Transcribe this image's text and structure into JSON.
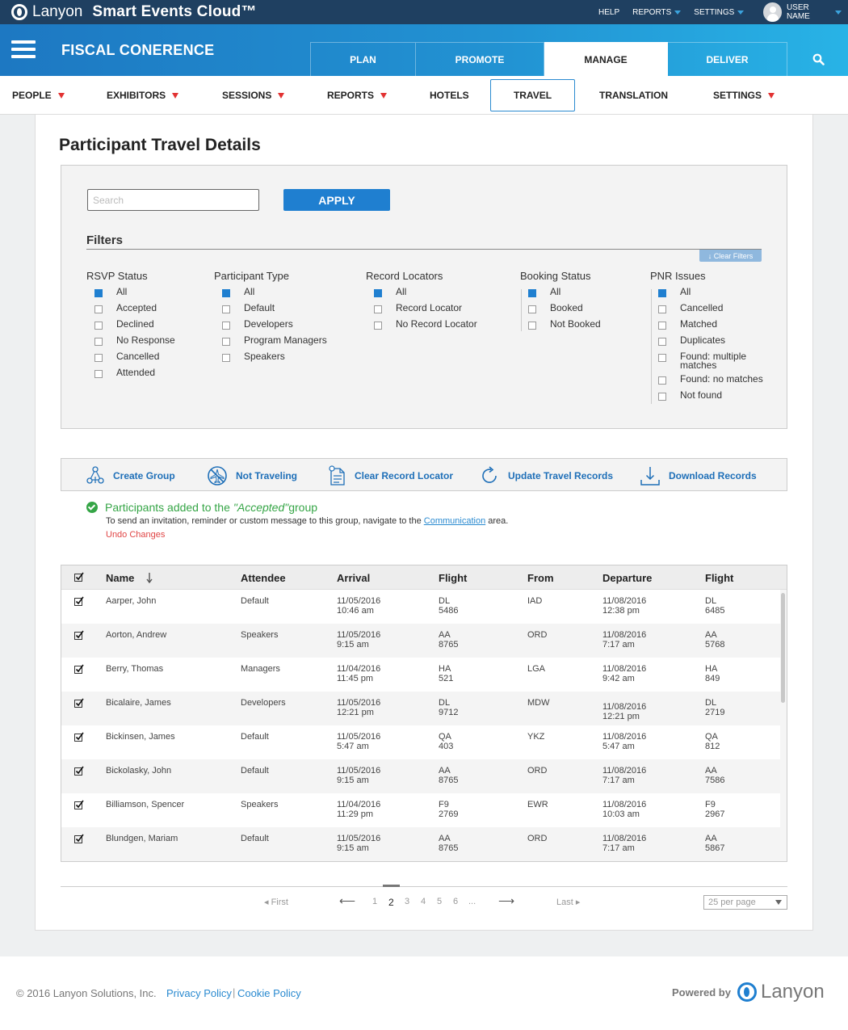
{
  "topbar": {
    "company": "Lanyon",
    "product": "Smart Events Cloud™",
    "links": {
      "help": "HELP",
      "reports": "REPORTS",
      "settings": "SETTINGS",
      "user": "USER NAME"
    }
  },
  "event": {
    "title": "FISCAL CONERENCE",
    "phases": [
      "PLAN",
      "PROMOTE",
      "MANAGE",
      "DELIVER"
    ],
    "active_phase": "MANAGE"
  },
  "manage_nav": {
    "items": [
      "PEOPLE",
      "EXHIBITORS",
      "SESSIONS",
      "REPORTS",
      "HOTELS",
      "TRAVEL",
      "TRANSLATION",
      "SETTINGS"
    ],
    "active": "TRAVEL"
  },
  "page": {
    "title": "Participant Travel Details"
  },
  "search": {
    "placeholder": "Search",
    "value": ""
  },
  "apply_label": "APPLY",
  "filters": {
    "heading": "Filters",
    "clear_label": "↓ Clear Filters",
    "groups": [
      {
        "title": "RSVP Status",
        "options": [
          {
            "label": "All",
            "checked": true
          },
          {
            "label": "Accepted",
            "checked": false
          },
          {
            "label": "Declined",
            "checked": false
          },
          {
            "label": "No Response",
            "checked": false
          },
          {
            "label": "Cancelled",
            "checked": false
          },
          {
            "label": "Attended",
            "checked": false
          }
        ]
      },
      {
        "title": "Participant Type",
        "options": [
          {
            "label": "All",
            "checked": true
          },
          {
            "label": "Default",
            "checked": false
          },
          {
            "label": "Developers",
            "checked": false
          },
          {
            "label": "Program Managers",
            "checked": false
          },
          {
            "label": "Speakers",
            "checked": false
          }
        ]
      },
      {
        "title": "Record Locators",
        "options": [
          {
            "label": "All",
            "checked": true
          },
          {
            "label": "Record Locator",
            "checked": false
          },
          {
            "label": "No Record Locator",
            "checked": false
          }
        ]
      },
      {
        "title": "Booking Status",
        "options": [
          {
            "label": "All",
            "checked": true
          },
          {
            "label": "Booked",
            "checked": false
          },
          {
            "label": "Not Booked",
            "checked": false
          }
        ]
      },
      {
        "title": "PNR Issues",
        "options": [
          {
            "label": "All",
            "checked": true
          },
          {
            "label": "Cancelled",
            "checked": false
          },
          {
            "label": "Matched",
            "checked": false
          },
          {
            "label": "Duplicates",
            "checked": false
          },
          {
            "label": "Found: multiple matches",
            "checked": false
          },
          {
            "label": "Found: no matches",
            "checked": false
          },
          {
            "label": "Not found",
            "checked": false
          }
        ]
      }
    ]
  },
  "actions": [
    "Create Group",
    "Not Traveling",
    "Clear Record Locator",
    "Update Travel Records",
    "Download Records"
  ],
  "notice": {
    "prefix": "Participants added to the ",
    "group": "\"Accepted\"",
    "suffix": " group",
    "sub_before": "To send an invitation, reminder or custom message to this group, navigate to the ",
    "sub_link": "Communication",
    "sub_after": " area.",
    "undo": "Undo Changes"
  },
  "table": {
    "columns": [
      "Name",
      "Attendee",
      "Arrival",
      "Flight",
      "From",
      "Departure",
      "Flight"
    ],
    "rows": [
      {
        "name": "Aarper, John",
        "attendee": "Default",
        "arr_date": "11/05/2016",
        "arr_time": "10:46 am",
        "f1_code": "DL",
        "f1_num": "5486",
        "from": "IAD",
        "dep_date": "11/08/2016",
        "dep_time": "12:38 pm",
        "f2_code": "DL",
        "f2_num": "6485"
      },
      {
        "name": "Aorton, Andrew",
        "attendee": "Speakers",
        "arr_date": "11/05/2016",
        "arr_time": "9:15 am",
        "f1_code": "AA",
        "f1_num": "8765",
        "from": "ORD",
        "dep_date": "11/08/2016",
        "dep_time": "7:17 am",
        "f2_code": "AA",
        "f2_num": "5768"
      },
      {
        "name": "Berry, Thomas",
        "attendee": "Managers",
        "arr_date": "11/04/2016",
        "arr_time": "11:45 pm",
        "f1_code": "HA",
        "f1_num": "521",
        "from": "LGA",
        "dep_date": "11/08/2016",
        "dep_time": "9:42 am",
        "f2_code": "HA",
        "f2_num": "849"
      },
      {
        "name": "Bicalaire, James",
        "attendee": "Developers",
        "arr_date": "11/05/2016",
        "arr_time": "12:21 pm",
        "f1_code": "DL",
        "f1_num": "9712",
        "from": "MDW",
        "dep_date": "11/08/2016",
        "dep_time": "12:21 pm",
        "f2_code": "DL",
        "f2_num": "2719"
      },
      {
        "name": "Bickinsen, James",
        "attendee": "Default",
        "arr_date": "11/05/2016",
        "arr_time": "5:47 am",
        "f1_code": "QA",
        "f1_num": "403",
        "from": "YKZ",
        "dep_date": "11/08/2016",
        "dep_time": "5:47 am",
        "f2_code": "QA",
        "f2_num": "812"
      },
      {
        "name": "Bickolasky, John",
        "attendee": "Default",
        "arr_date": "11/05/2016",
        "arr_time": "9:15 am",
        "f1_code": "AA",
        "f1_num": "8765",
        "from": "ORD",
        "dep_date": "11/08/2016",
        "dep_time": "7:17 am",
        "f2_code": "AA",
        "f2_num": "7586"
      },
      {
        "name": "Billiamson, Spencer",
        "attendee": "Speakers",
        "arr_date": "11/04/2016",
        "arr_time": "11:29 pm",
        "f1_code": "F9",
        "f1_num": "2769",
        "from": "EWR",
        "dep_date": "11/08/2016",
        "dep_time": "10:03 am",
        "f2_code": "F9",
        "f2_num": "2967"
      },
      {
        "name": "Blundgen, Mariam",
        "attendee": "Default",
        "arr_date": "11/05/2016",
        "arr_time": "9:15 am",
        "f1_code": "AA",
        "f1_num": "8765",
        "from": "ORD",
        "dep_date": "11/08/2016",
        "dep_time": "7:17 am",
        "f2_code": "AA",
        "f2_num": "5867"
      }
    ]
  },
  "pagination": {
    "first": "First",
    "last": "Last",
    "pages": [
      "1",
      "2",
      "3",
      "4",
      "5",
      "6",
      "..."
    ],
    "current": "2",
    "per_page": "25 per page"
  },
  "footer": {
    "copyright": "© 2016 Lanyon Solutions, Inc.",
    "privacy": "Privacy Policy",
    "separator": "|",
    "cookie": "Cookie Policy",
    "powered_by": "Powered by",
    "brand": "Lanyon"
  },
  "colors": {
    "accent": "#1f7fd0",
    "header": "#1f4061",
    "success": "#35a546",
    "danger": "#e04545",
    "nav_caret": "#e23232"
  },
  "icons": [
    "search-icon",
    "hamburger-icon",
    "user-avatar-icon",
    "create-group-icon",
    "not-traveling-icon",
    "clear-record-locator-icon",
    "update-records-icon",
    "download-icon",
    "success-check-icon",
    "sort-down-icon"
  ]
}
